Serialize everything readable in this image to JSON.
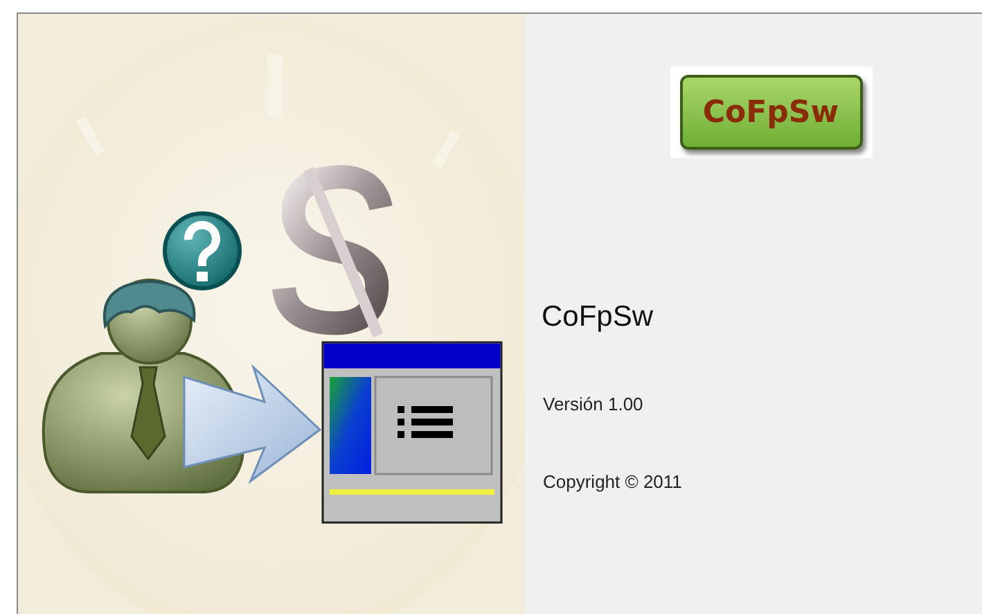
{
  "logo": {
    "text": "CoFpSw"
  },
  "product_name": "CoFpSw",
  "version": "Versión 1.00",
  "copyright": "Copyright © 2011"
}
